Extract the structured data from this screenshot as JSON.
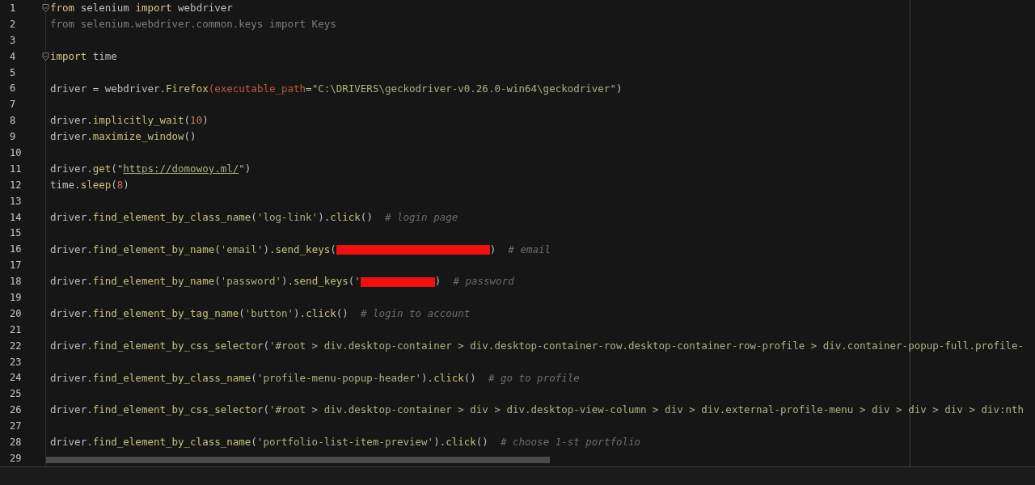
{
  "editor": {
    "lines": [
      {
        "number": "1",
        "foldable": true,
        "tokens": [
          {
            "kind": "kw",
            "text": "from"
          },
          {
            "kind": "plain",
            "text": " selenium "
          },
          {
            "kind": "kw",
            "text": "import"
          },
          {
            "kind": "plain",
            "text": " webdriver"
          }
        ]
      },
      {
        "number": "2",
        "tokens": [
          {
            "kind": "dim",
            "text": "from selenium.webdriver.common.keys import Keys"
          }
        ]
      },
      {
        "number": "3"
      },
      {
        "number": "4",
        "foldable": true,
        "tokens": [
          {
            "kind": "kw",
            "text": "import"
          },
          {
            "kind": "plain",
            "text": " time"
          }
        ]
      },
      {
        "number": "5"
      },
      {
        "number": "6",
        "tokens": [
          {
            "kind": "plain",
            "text": "driver = webdriver."
          },
          {
            "kind": "fn",
            "text": "Firefox"
          },
          {
            "kind": "param",
            "text": "(executable_path"
          },
          {
            "kind": "plain",
            "text": "="
          },
          {
            "kind": "str",
            "text": "\"C:\\DRIVERS\\geckodriver-v0.26.0-win64\\geckodriver\""
          },
          {
            "kind": "plain",
            "text": ")"
          }
        ]
      },
      {
        "number": "7"
      },
      {
        "number": "8",
        "tokens": [
          {
            "kind": "plain",
            "text": "driver."
          },
          {
            "kind": "fn",
            "text": "implicitly_wait"
          },
          {
            "kind": "plain",
            "text": "("
          },
          {
            "kind": "num",
            "text": "10"
          },
          {
            "kind": "plain",
            "text": ")"
          }
        ]
      },
      {
        "number": "9",
        "tokens": [
          {
            "kind": "plain",
            "text": "driver."
          },
          {
            "kind": "fn",
            "text": "maximize_window"
          },
          {
            "kind": "plain",
            "text": "()"
          }
        ]
      },
      {
        "number": "10"
      },
      {
        "number": "11",
        "tokens": [
          {
            "kind": "plain",
            "text": "driver."
          },
          {
            "kind": "fn",
            "text": "get"
          },
          {
            "kind": "plain",
            "text": "("
          },
          {
            "kind": "str",
            "text": "\""
          },
          {
            "kind": "url",
            "text": "https://domowoy.ml/"
          },
          {
            "kind": "str",
            "text": "\""
          },
          {
            "kind": "plain",
            "text": ")"
          }
        ]
      },
      {
        "number": "12",
        "tokens": [
          {
            "kind": "plain",
            "text": "time."
          },
          {
            "kind": "fn",
            "text": "sleep"
          },
          {
            "kind": "plain",
            "text": "("
          },
          {
            "kind": "num",
            "text": "8"
          },
          {
            "kind": "plain",
            "text": ")"
          }
        ]
      },
      {
        "number": "13"
      },
      {
        "number": "14",
        "tokens": [
          {
            "kind": "plain",
            "text": "driver."
          },
          {
            "kind": "fn",
            "text": "find_element_by_class_name"
          },
          {
            "kind": "plain",
            "text": "("
          },
          {
            "kind": "str",
            "text": "'log-link'"
          },
          {
            "kind": "plain",
            "text": ")."
          },
          {
            "kind": "fn",
            "text": "click"
          },
          {
            "kind": "plain",
            "text": "()  "
          },
          {
            "kind": "comment",
            "text": "# login page"
          }
        ]
      },
      {
        "number": "15"
      },
      {
        "number": "16",
        "tokens": [
          {
            "kind": "plain",
            "text": "driver."
          },
          {
            "kind": "fn",
            "text": "find_element_by_name"
          },
          {
            "kind": "plain",
            "text": "("
          },
          {
            "kind": "str",
            "text": "'email'"
          },
          {
            "kind": "plain",
            "text": ")."
          },
          {
            "kind": "fn",
            "text": "send_keys"
          },
          {
            "kind": "plain",
            "text": "("
          },
          {
            "kind": "redactedwide"
          },
          {
            "kind": "plain",
            "text": ")  "
          },
          {
            "kind": "comment",
            "text": "# email"
          }
        ]
      },
      {
        "number": "17"
      },
      {
        "number": "18",
        "tokens": [
          {
            "kind": "plain",
            "text": "driver."
          },
          {
            "kind": "fn",
            "text": "find_element_by_name"
          },
          {
            "kind": "plain",
            "text": "("
          },
          {
            "kind": "str",
            "text": "'password'"
          },
          {
            "kind": "plain",
            "text": ")."
          },
          {
            "kind": "fn",
            "text": "send_keys"
          },
          {
            "kind": "plain",
            "text": "("
          },
          {
            "kind": "str",
            "text": "'"
          },
          {
            "kind": "redacted"
          },
          {
            "kind": "plain",
            "text": ")  "
          },
          {
            "kind": "comment",
            "text": "# password"
          }
        ]
      },
      {
        "number": "19"
      },
      {
        "number": "20",
        "tokens": [
          {
            "kind": "plain",
            "text": "driver."
          },
          {
            "kind": "fn",
            "text": "find_element_by_tag_name"
          },
          {
            "kind": "plain",
            "text": "("
          },
          {
            "kind": "str",
            "text": "'button'"
          },
          {
            "kind": "plain",
            "text": ")."
          },
          {
            "kind": "fn",
            "text": "click"
          },
          {
            "kind": "plain",
            "text": "()  "
          },
          {
            "kind": "comment",
            "text": "# login to account"
          }
        ]
      },
      {
        "number": "21"
      },
      {
        "number": "22",
        "tokens": [
          {
            "kind": "plain",
            "text": "driver."
          },
          {
            "kind": "fn",
            "text": "find_element_by_css_selector"
          },
          {
            "kind": "plain",
            "text": "("
          },
          {
            "kind": "str",
            "text": "'#root > div.desktop-container > div.desktop-container-row.desktop-container-row-profile > div.container-popup-full.profile-"
          }
        ]
      },
      {
        "number": "23"
      },
      {
        "number": "24",
        "tokens": [
          {
            "kind": "plain",
            "text": "driver."
          },
          {
            "kind": "fn",
            "text": "find_element_by_class_name"
          },
          {
            "kind": "plain",
            "text": "("
          },
          {
            "kind": "str",
            "text": "'profile-menu-popup-header'"
          },
          {
            "kind": "plain",
            "text": ")."
          },
          {
            "kind": "fn",
            "text": "click"
          },
          {
            "kind": "plain",
            "text": "()  "
          },
          {
            "kind": "comment",
            "text": "# go to profile"
          }
        ]
      },
      {
        "number": "25"
      },
      {
        "number": "26",
        "tokens": [
          {
            "kind": "plain",
            "text": "driver."
          },
          {
            "kind": "fn",
            "text": "find_element_by_css_selector"
          },
          {
            "kind": "plain",
            "text": "("
          },
          {
            "kind": "str",
            "text": "'#root > div.desktop-container > div > div.desktop-view-column > div > div.external-profile-menu > div > div > div > div:nth"
          }
        ]
      },
      {
        "number": "27"
      },
      {
        "number": "28",
        "tokens": [
          {
            "kind": "plain",
            "text": "driver."
          },
          {
            "kind": "fn",
            "text": "find_element_by_class_name"
          },
          {
            "kind": "plain",
            "text": "("
          },
          {
            "kind": "str",
            "text": "'portfolio-list-item-preview'"
          },
          {
            "kind": "plain",
            "text": ")."
          },
          {
            "kind": "fn",
            "text": "click"
          },
          {
            "kind": "plain",
            "text": "()  "
          },
          {
            "kind": "comment",
            "text": "# choose 1-st portfolio"
          }
        ]
      },
      {
        "number": "29"
      }
    ]
  }
}
